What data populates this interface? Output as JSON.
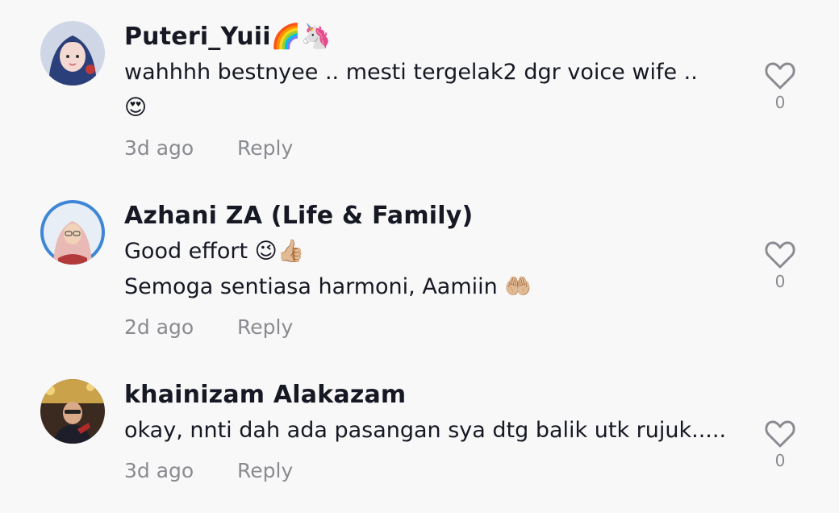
{
  "comments": [
    {
      "username": "Puteri_Yuii🌈🦄",
      "text": "wahhhh bestnyee .. mesti tergelak2 dgr voice wife ..\n😍",
      "time": "3d ago",
      "reply_label": "Reply",
      "likes": "0"
    },
    {
      "username": "Azhani ZA (Life & Family)",
      "text": "Good effort 😉👍🏼\nSemoga sentiasa harmoni, Aamiin 🤲🏼",
      "time": "2d ago",
      "reply_label": "Reply",
      "likes": "0"
    },
    {
      "username": "khainizam Alakazam",
      "text": "okay, nnti dah ada pasangan sya dtg balik utk rujuk.....",
      "time": "3d ago",
      "reply_label": "Reply",
      "likes": "0"
    }
  ],
  "colors": {
    "background": "#f8f8f8",
    "text": "#161823",
    "secondary": "#8a8b91"
  },
  "icons": {
    "like": "heart-outline-icon"
  }
}
